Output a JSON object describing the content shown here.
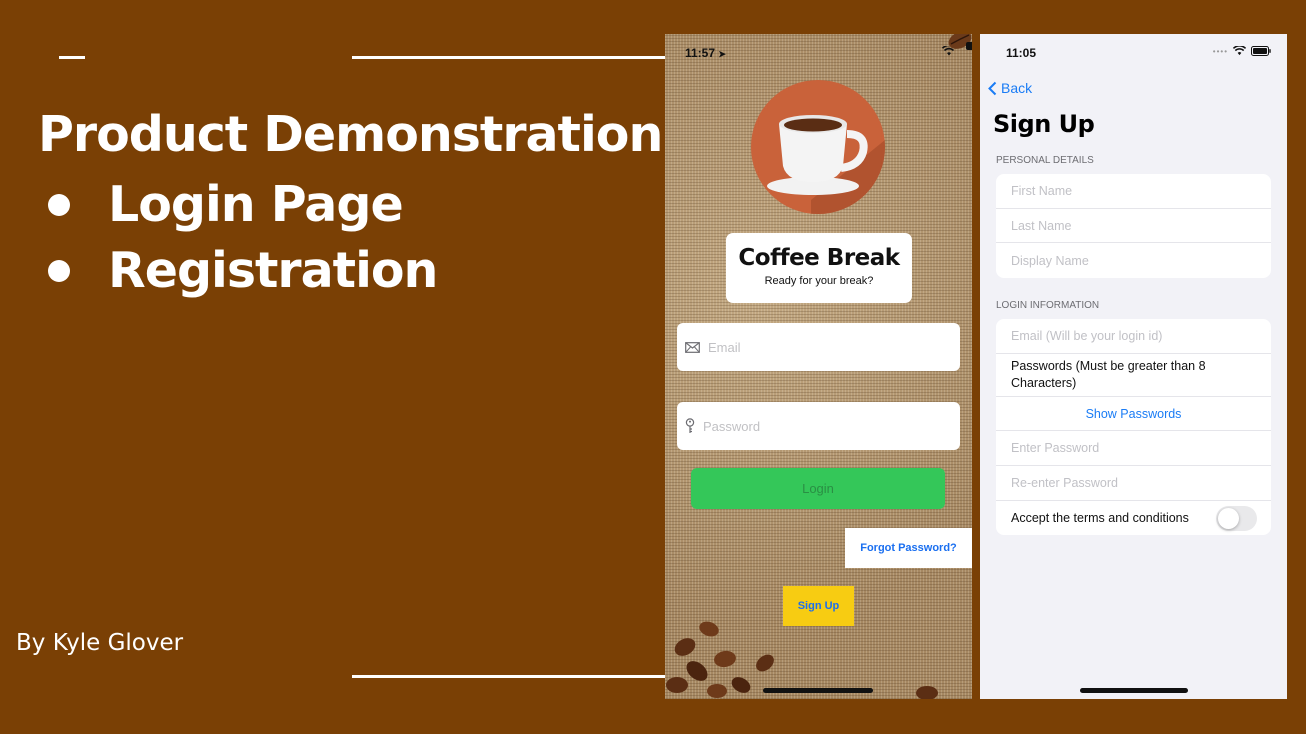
{
  "slide": {
    "title": "Product Demonstration",
    "bullets": [
      "Login Page",
      "Registration"
    ],
    "author": "By Kyle Glover"
  },
  "login_screen": {
    "status_time": "11:57",
    "brand_title": "Coffee Break",
    "brand_subtitle": "Ready for your break?",
    "email_placeholder": "Email",
    "password_placeholder": "Password",
    "login_label": "Login",
    "forgot_label": "Forgot Password?",
    "signup_label": "Sign Up",
    "icons": [
      "location-arrow-icon",
      "wifi-icon",
      "battery-icon",
      "envelope-icon",
      "key-icon",
      "coffee-cup-icon"
    ]
  },
  "signup_screen": {
    "status_time": "11:05",
    "back_label": "Back",
    "title": "Sign Up",
    "personal_header": "PERSONAL DETAILS",
    "personal_fields": [
      "First Name",
      "Last Name",
      "Display Name"
    ],
    "login_header": "LOGIN INFORMATION",
    "email_placeholder": "Email (Will be your login id)",
    "password_note": "Passwords (Must be greater than 8 Characters)",
    "show_passwords": "Show Passwords",
    "enter_password": "Enter Password",
    "reenter_password": "Re-enter Password",
    "terms_label": "Accept the terms and conditions",
    "terms_accepted": false
  },
  "colors": {
    "slide_bg": "#7a4005",
    "login_green": "#34c759",
    "signup_yellow": "#f7cc12",
    "ios_blue": "#1a7cf5"
  }
}
